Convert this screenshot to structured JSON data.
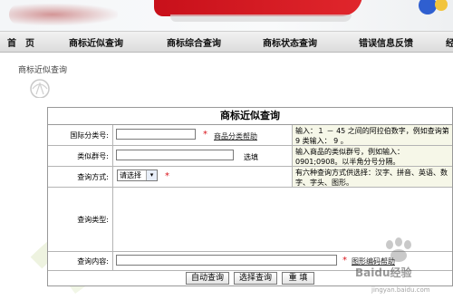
{
  "nav": {
    "items": [
      {
        "label": "首　页"
      },
      {
        "label": "商标近似查询"
      },
      {
        "label": "商标综合查询"
      },
      {
        "label": "商标状态查询"
      },
      {
        "label": "错误信息反馈"
      },
      {
        "label": "经"
      }
    ]
  },
  "breadcrumb": "商标近似查询",
  "form": {
    "title": "商标近似查询",
    "class_no": {
      "label": "国际分类号:",
      "required": "*",
      "help_link": "商品分类帮助",
      "hint": "输入：１ － 45 之间的阿拉伯数字，例如查询第 9 类输入： 9 。",
      "value": ""
    },
    "group_no": {
      "label": "类似群号:",
      "note": "选填",
      "hint": "输入商品的类似群号，例如输入：0901;0908。以半角分号分隔。",
      "value": ""
    },
    "query_mode": {
      "label": "查询方式:",
      "selected": "请选择",
      "arrow": "▾",
      "required": "*",
      "hint": "有六种查询方式供选择：汉字、拼音、英语、数字、字头、图形。"
    },
    "query_type": {
      "label": "查询类型:"
    },
    "query_content": {
      "label": "查询内容:",
      "required": "*",
      "link": "图形编码帮助",
      "value": ""
    },
    "buttons": {
      "auto": "自动查询",
      "select": "选择查询",
      "reset": "重 填"
    }
  },
  "watermark": {
    "text": "Baidu经验",
    "sub": "jingyan.baidu.com"
  },
  "colors": {
    "accent": "#c8101a",
    "required": "#d9131a",
    "hint_bg": "#f6f7e8"
  }
}
